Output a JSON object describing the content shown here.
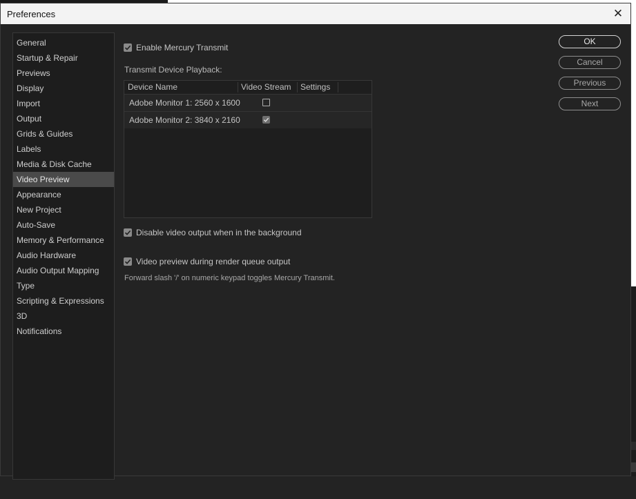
{
  "window": {
    "title": "Preferences",
    "close_glyph": "✕"
  },
  "sidebar": {
    "items": [
      {
        "label": "General"
      },
      {
        "label": "Startup & Repair"
      },
      {
        "label": "Previews"
      },
      {
        "label": "Display"
      },
      {
        "label": "Import"
      },
      {
        "label": "Output"
      },
      {
        "label": "Grids & Guides"
      },
      {
        "label": "Labels"
      },
      {
        "label": "Media & Disk Cache"
      },
      {
        "label": "Video Preview"
      },
      {
        "label": "Appearance"
      },
      {
        "label": "New Project"
      },
      {
        "label": "Auto-Save"
      },
      {
        "label": "Memory & Performance"
      },
      {
        "label": "Audio Hardware"
      },
      {
        "label": "Audio Output Mapping"
      },
      {
        "label": "Type"
      },
      {
        "label": "Scripting & Expressions"
      },
      {
        "label": "3D"
      },
      {
        "label": "Notifications"
      }
    ],
    "selected": "Video Preview"
  },
  "main": {
    "enable_mercury": {
      "label": "Enable Mercury Transmit",
      "checked": true
    },
    "transmit_heading": "Transmit Device Playback:",
    "table": {
      "columns": [
        "Device Name",
        "Video Stream",
        "Settings"
      ],
      "rows": [
        {
          "device": "Adobe Monitor 1: 2560 x 1600",
          "video_stream": false
        },
        {
          "device": "Adobe Monitor 2: 3840 x 2160",
          "video_stream": true
        }
      ]
    },
    "disable_bg": {
      "label": "Disable video output when in the background",
      "checked": true
    },
    "render_queue": {
      "label": "Video preview during render queue output",
      "checked": true
    },
    "hint": "Forward slash '/' on numeric keypad toggles Mercury Transmit."
  },
  "buttons": {
    "ok": "OK",
    "cancel": "Cancel",
    "previous": "Previous",
    "next": "Next"
  }
}
